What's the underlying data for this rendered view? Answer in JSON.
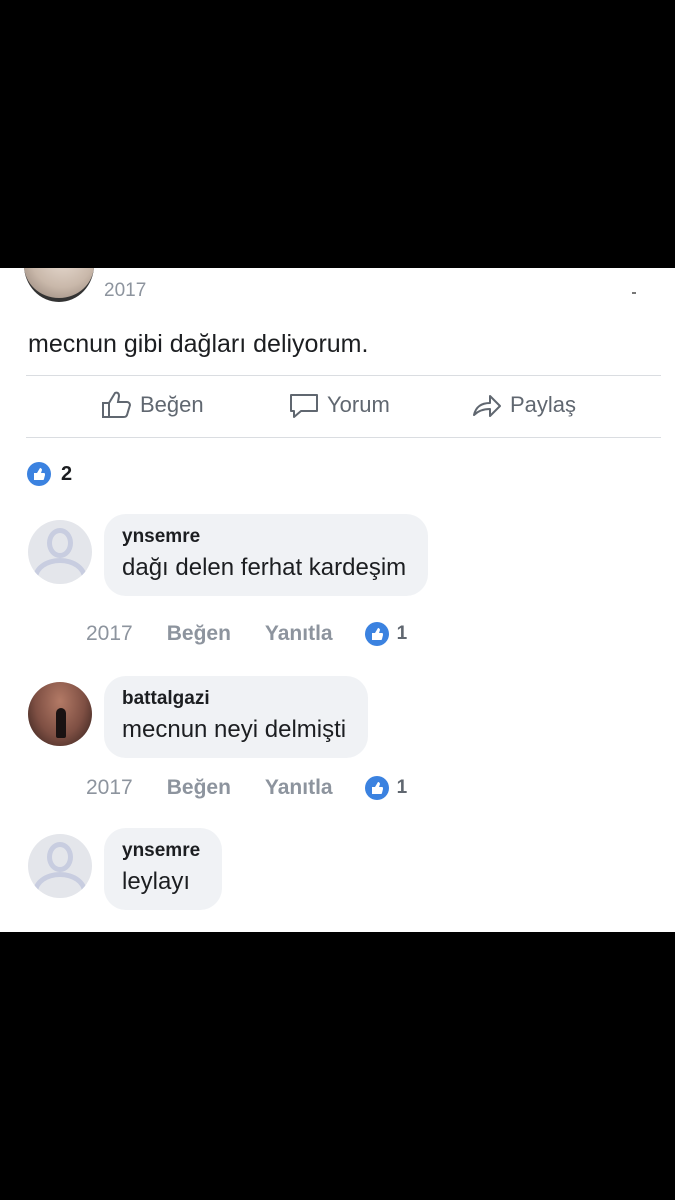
{
  "post": {
    "year": "2017",
    "text": "mecnun gibi dağları deliyorum."
  },
  "actions": {
    "like_label": "Beğen",
    "comment_label": "Yorum",
    "share_label": "Paylaş"
  },
  "reactions": {
    "count": "2"
  },
  "comments": [
    {
      "author": "ynsemre",
      "text": "dağı delen ferhat kardeşim",
      "year": "2017",
      "like_label": "Beğen",
      "reply_label": "Yanıtla",
      "likes": "1",
      "avatar": "placeholder"
    },
    {
      "author": "battalgazi",
      "text": "mecnun neyi delmişti",
      "year": "2017",
      "like_label": "Beğen",
      "reply_label": "Yanıtla",
      "likes": "1",
      "avatar": "photo"
    },
    {
      "author": "ynsemre",
      "text": "leylayı",
      "avatar": "placeholder"
    }
  ],
  "colors": {
    "accent": "#3b82e0",
    "bubble": "#f0f2f5",
    "muted": "#8d949e"
  }
}
